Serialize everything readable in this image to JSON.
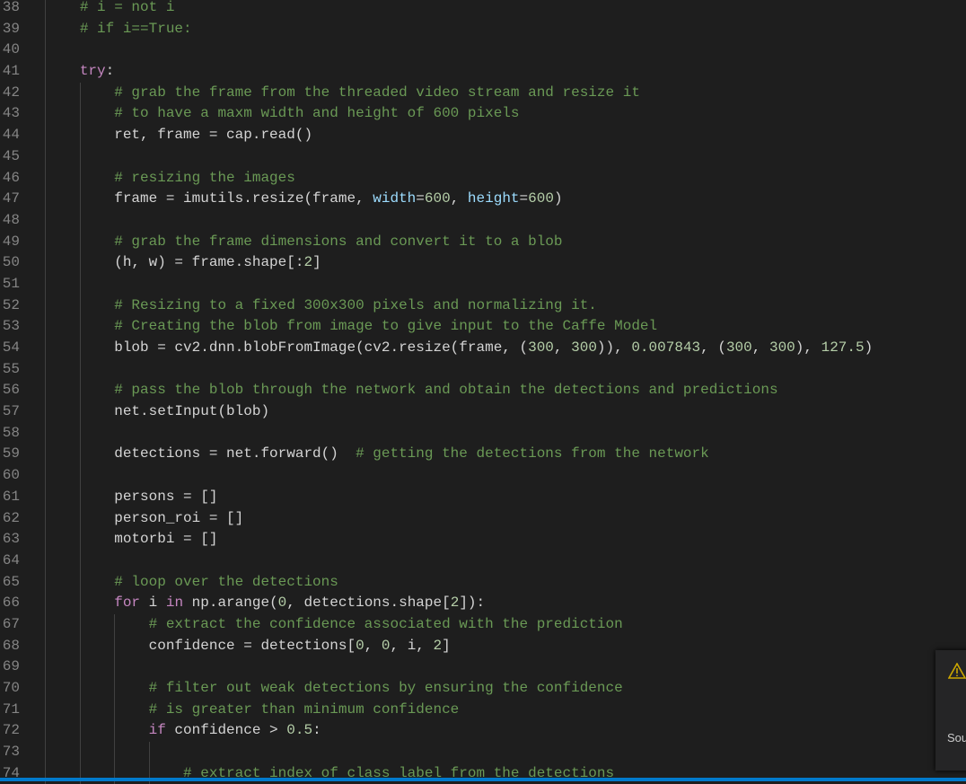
{
  "colors": {
    "accent": "#007acc",
    "background": "#1e1e1e",
    "warning": "#cca700"
  },
  "editor": {
    "lines": [
      {
        "num": "38",
        "tokens": [
          [
            "c",
            "        # i = not i"
          ]
        ]
      },
      {
        "num": "39",
        "tokens": [
          [
            "c",
            "        # if i==True:"
          ]
        ]
      },
      {
        "num": "40",
        "tokens": []
      },
      {
        "num": "41",
        "tokens": [
          [
            "k",
            "        try"
          ],
          [
            "t",
            ":"
          ]
        ]
      },
      {
        "num": "42",
        "tokens": [
          [
            "c",
            "            # grab the frame from the threaded video stream and resize it"
          ]
        ]
      },
      {
        "num": "43",
        "tokens": [
          [
            "c",
            "            # to have a maxm width and height of 600 pixels"
          ]
        ]
      },
      {
        "num": "44",
        "tokens": [
          [
            "t",
            "            ret, frame = cap.read()"
          ]
        ]
      },
      {
        "num": "45",
        "tokens": []
      },
      {
        "num": "46",
        "tokens": [
          [
            "c",
            "            # resizing the images"
          ]
        ]
      },
      {
        "num": "47",
        "tokens": [
          [
            "t",
            "            frame = imutils.resize(frame, "
          ],
          [
            "v",
            "width"
          ],
          [
            "t",
            "="
          ],
          [
            "n",
            "600"
          ],
          [
            "t",
            ", "
          ],
          [
            "v",
            "height"
          ],
          [
            "t",
            "="
          ],
          [
            "n",
            "600"
          ],
          [
            "t",
            ")"
          ]
        ]
      },
      {
        "num": "48",
        "tokens": []
      },
      {
        "num": "49",
        "tokens": [
          [
            "c",
            "            # grab the frame dimensions and convert it to a blob"
          ]
        ]
      },
      {
        "num": "50",
        "tokens": [
          [
            "t",
            "            (h, w) = frame.shape[:"
          ],
          [
            "n",
            "2"
          ],
          [
            "t",
            "]"
          ]
        ]
      },
      {
        "num": "51",
        "tokens": []
      },
      {
        "num": "52",
        "tokens": [
          [
            "c",
            "            # Resizing to a fixed 300x300 pixels and normalizing it."
          ]
        ]
      },
      {
        "num": "53",
        "tokens": [
          [
            "c",
            "            # Creating the blob from image to give input to the Caffe Model"
          ]
        ]
      },
      {
        "num": "54",
        "tokens": [
          [
            "t",
            "            blob = cv2.dnn.blobFromImage(cv2.resize(frame, ("
          ],
          [
            "n",
            "300"
          ],
          [
            "t",
            ", "
          ],
          [
            "n",
            "300"
          ],
          [
            "t",
            ")), "
          ],
          [
            "n",
            "0.007843"
          ],
          [
            "t",
            ", ("
          ],
          [
            "n",
            "300"
          ],
          [
            "t",
            ", "
          ],
          [
            "n",
            "300"
          ],
          [
            "t",
            "), "
          ],
          [
            "n",
            "127.5"
          ],
          [
            "t",
            ")"
          ]
        ]
      },
      {
        "num": "55",
        "tokens": []
      },
      {
        "num": "56",
        "tokens": [
          [
            "c",
            "            # pass the blob through the network and obtain the detections and predictions"
          ]
        ]
      },
      {
        "num": "57",
        "tokens": [
          [
            "t",
            "            net.setInput(blob)"
          ]
        ]
      },
      {
        "num": "58",
        "tokens": []
      },
      {
        "num": "59",
        "tokens": [
          [
            "t",
            "            detections = net.forward()  "
          ],
          [
            "c",
            "# getting the detections from the network"
          ]
        ]
      },
      {
        "num": "60",
        "tokens": []
      },
      {
        "num": "61",
        "tokens": [
          [
            "t",
            "            persons = []"
          ]
        ]
      },
      {
        "num": "62",
        "tokens": [
          [
            "t",
            "            person_roi = []"
          ]
        ]
      },
      {
        "num": "63",
        "tokens": [
          [
            "t",
            "            motorbi = []"
          ]
        ]
      },
      {
        "num": "64",
        "tokens": []
      },
      {
        "num": "65",
        "tokens": [
          [
            "c",
            "            # loop over the detections"
          ]
        ]
      },
      {
        "num": "66",
        "tokens": [
          [
            "k",
            "            for"
          ],
          [
            "t",
            " i "
          ],
          [
            "k",
            "in"
          ],
          [
            "t",
            " np.arange("
          ],
          [
            "n",
            "0"
          ],
          [
            "t",
            ", detections.shape["
          ],
          [
            "n",
            "2"
          ],
          [
            "t",
            "]):"
          ]
        ]
      },
      {
        "num": "67",
        "tokens": [
          [
            "c",
            "                # extract the confidence associated with the prediction"
          ]
        ]
      },
      {
        "num": "68",
        "tokens": [
          [
            "t",
            "                confidence = detections["
          ],
          [
            "n",
            "0"
          ],
          [
            "t",
            ", "
          ],
          [
            "n",
            "0"
          ],
          [
            "t",
            ", i, "
          ],
          [
            "n",
            "2"
          ],
          [
            "t",
            "]"
          ]
        ]
      },
      {
        "num": "69",
        "tokens": []
      },
      {
        "num": "70",
        "tokens": [
          [
            "c",
            "                # filter out weak detections by ensuring the confidence"
          ]
        ]
      },
      {
        "num": "71",
        "tokens": [
          [
            "c",
            "                # is greater than minimum confidence"
          ]
        ]
      },
      {
        "num": "72",
        "tokens": [
          [
            "k",
            "                if"
          ],
          [
            "t",
            " confidence > "
          ],
          [
            "n",
            "0.5"
          ],
          [
            "t",
            ":"
          ]
        ]
      },
      {
        "num": "73",
        "tokens": []
      },
      {
        "num": "74",
        "tokens": [
          [
            "c",
            "                    # extract index of class label from the detections"
          ]
        ]
      }
    ]
  },
  "notification": {
    "icon": "warning-icon",
    "text": "Sou"
  }
}
